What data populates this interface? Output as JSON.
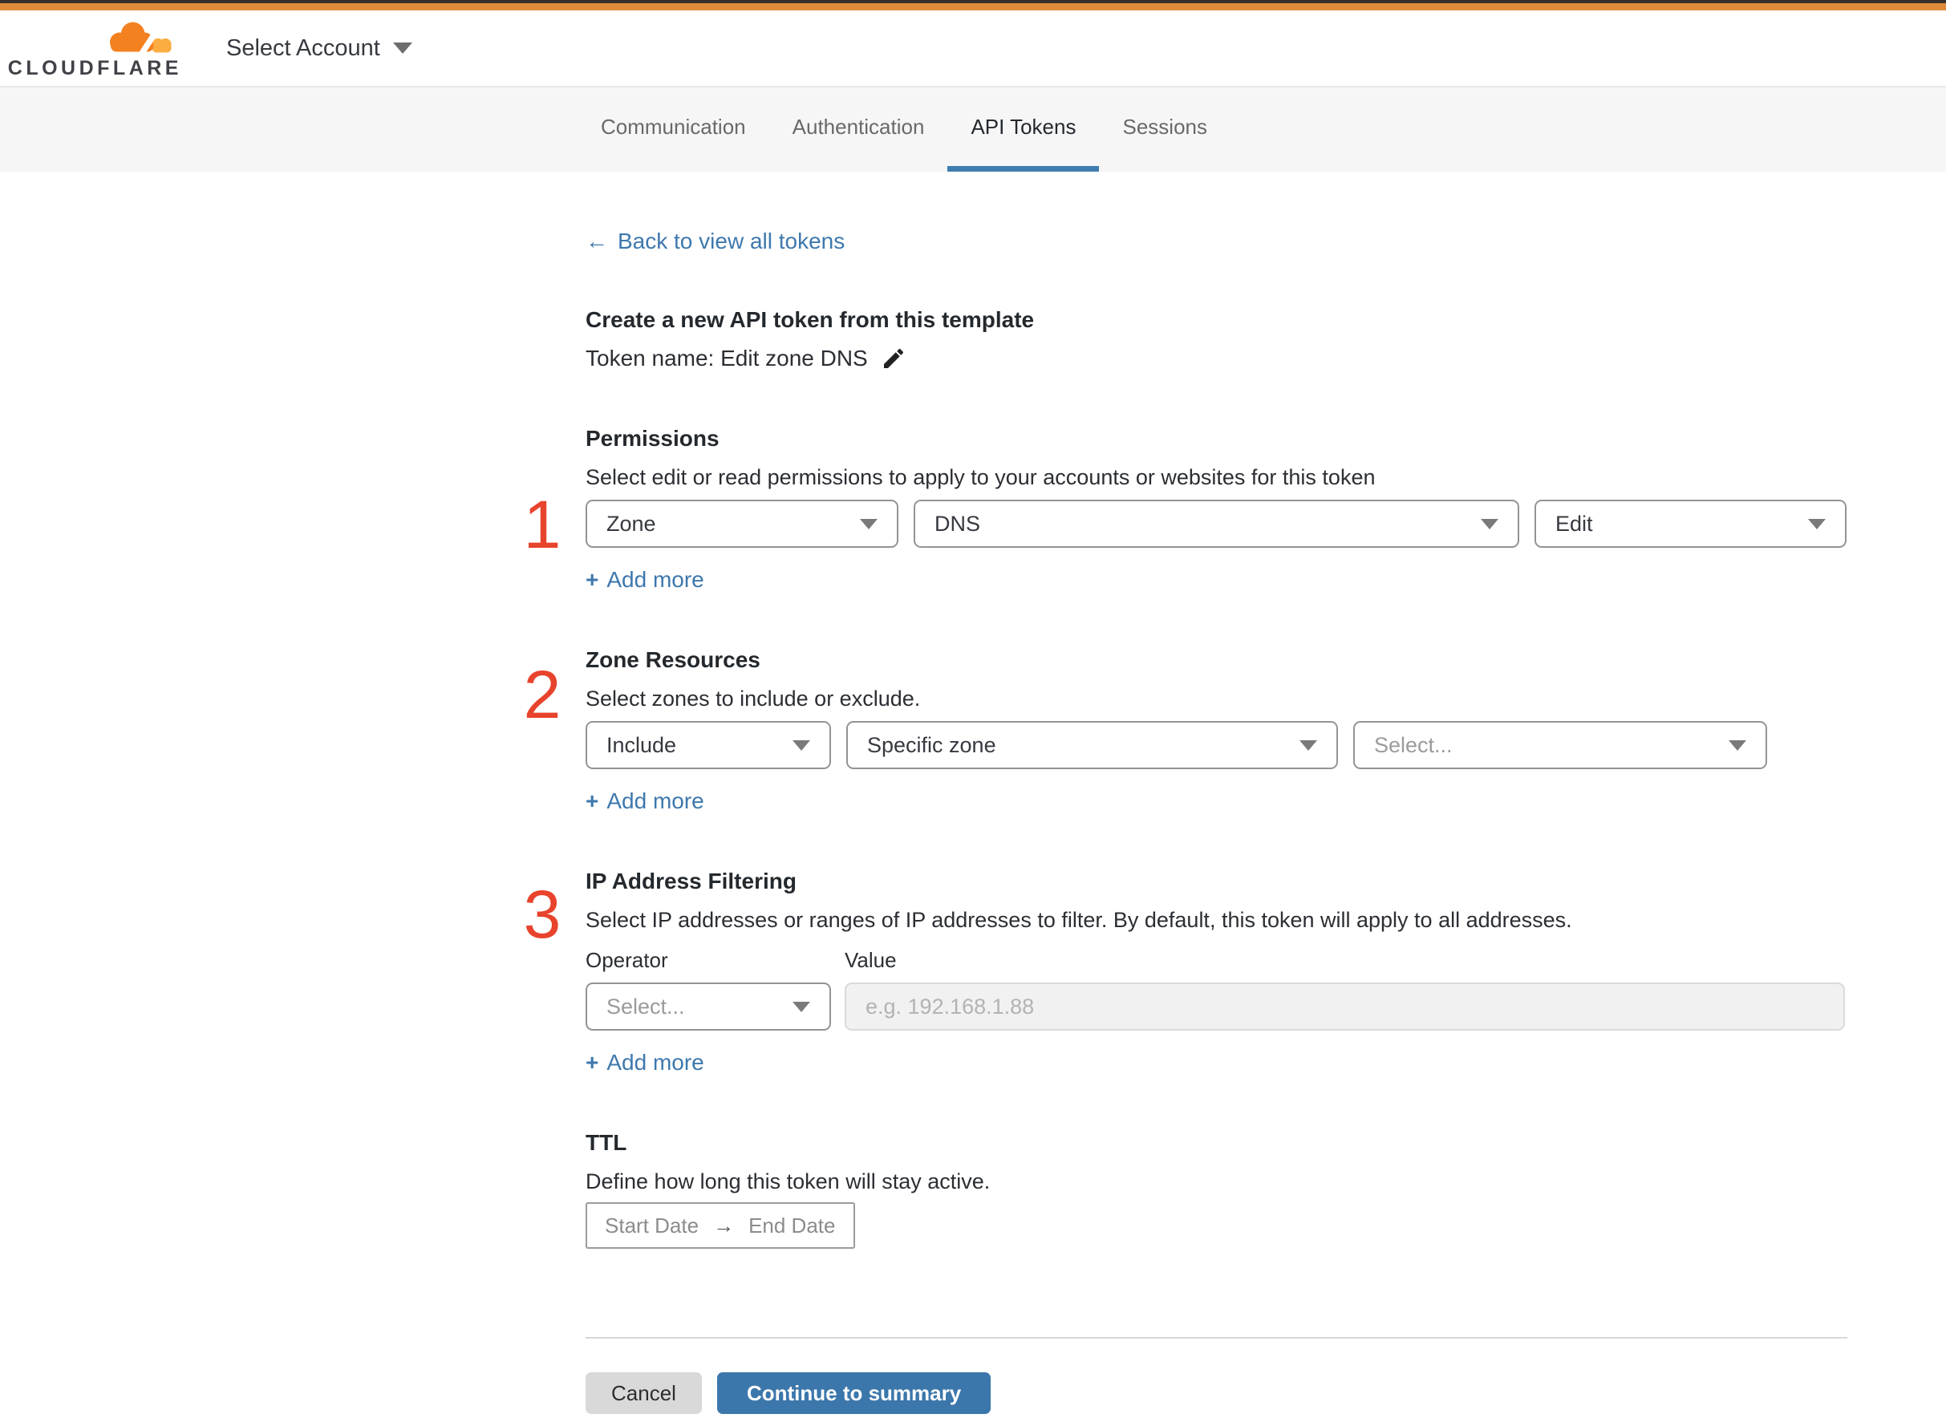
{
  "header": {
    "logo_text": "CLOUDFLARE",
    "account_selector_label": "Select Account"
  },
  "tabs": {
    "items": [
      {
        "label": "Communication",
        "active": false
      },
      {
        "label": "Authentication",
        "active": false
      },
      {
        "label": "API Tokens",
        "active": true
      },
      {
        "label": "Sessions",
        "active": false
      }
    ]
  },
  "icons": {
    "back_arrow": "←",
    "plus": "+",
    "range_arrow": "→",
    "chevron_down": "caret-down-triangle",
    "edit_pencil": "pencil"
  },
  "page": {
    "back_link": "Back to view all tokens",
    "annotations": {
      "one": "1",
      "two": "2",
      "three": "3"
    },
    "step1": {
      "title": "Create a new API token from this template",
      "token_name": "Token name: Edit zone DNS"
    },
    "permissions": {
      "title": "Permissions",
      "description": "Select edit or read permissions to apply to your accounts or websites for this token",
      "selects": [
        {
          "value": "Zone"
        },
        {
          "value": "DNS"
        },
        {
          "value": "Edit"
        }
      ],
      "add_more": "Add more"
    },
    "zone_resources": {
      "title": "Zone Resources",
      "description": "Select zones to include or exclude.",
      "selects": [
        {
          "value": "Include"
        },
        {
          "value": "Specific zone"
        },
        {
          "value": "Select..."
        }
      ],
      "add_more": "Add more"
    },
    "ip_filtering": {
      "title": "IP Address Filtering",
      "description": "Select IP addresses or ranges of IP addresses to filter. By default, this token will apply to all addresses.",
      "operator_label": "Operator",
      "value_label": "Value",
      "operator_value": "Select...",
      "value_placeholder": "e.g. 192.168.1.88",
      "add_more": "Add more"
    },
    "ttl": {
      "title": "TTL",
      "description": "Define how long this token will stay active.",
      "start_date": "Start Date",
      "end_date": "End Date"
    },
    "footer": {
      "cancel": "Cancel",
      "continue": "Continue to summary"
    }
  },
  "colors": {
    "accent_blue": "#3e7cb1",
    "link_blue": "#3e78ad",
    "annotation_red": "#e8432c",
    "top_bar_orange": "#e08b3b",
    "cloudflare_orange": "#f48120",
    "cloudflare_gold": "#fbad41",
    "tabbar_bg": "#f6f6f7",
    "disabled_input_bg": "#f1f1f1",
    "cancel_gray": "#d9d9d9"
  }
}
